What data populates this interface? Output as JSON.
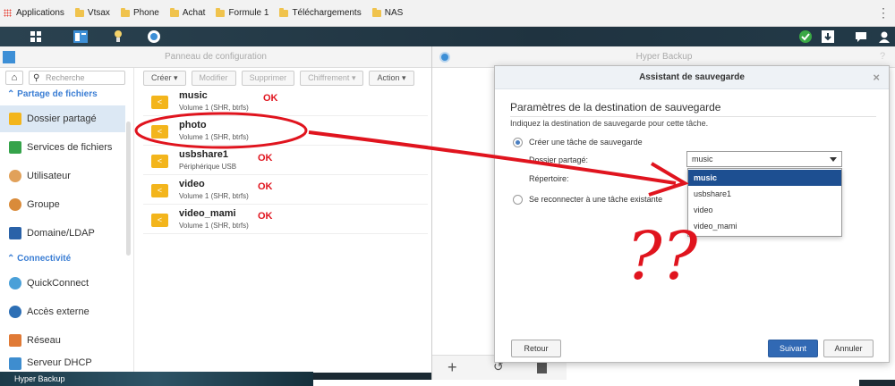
{
  "bookmarks": {
    "apps_label": "Applications",
    "items": [
      "Vtsax",
      "Phone",
      "Achat",
      "Formule 1",
      "Téléchargements",
      "NAS"
    ]
  },
  "control_panel": {
    "title": "Panneau de configuration",
    "search_placeholder": "Recherche",
    "sections": {
      "file_sharing": "Partage de fichiers",
      "connectivity": "Connectivité"
    },
    "sidebar_items": [
      {
        "label": "Dossier partagé",
        "icon": "shared-folder-icon",
        "active": true
      },
      {
        "label": "Services de fichiers",
        "icon": "file-services-icon"
      },
      {
        "label": "Utilisateur",
        "icon": "user-icon"
      },
      {
        "label": "Groupe",
        "icon": "group-icon"
      },
      {
        "label": "Domaine/LDAP",
        "icon": "domain-icon"
      },
      {
        "label": "QuickConnect",
        "icon": "quickconnect-icon"
      },
      {
        "label": "Accès externe",
        "icon": "external-access-icon"
      },
      {
        "label": "Réseau",
        "icon": "network-icon"
      },
      {
        "label": "Serveur DHCP",
        "icon": "dhcp-icon"
      }
    ],
    "toolbar": {
      "create": "Créer",
      "modify": "Modifier",
      "delete": "Supprimer",
      "encryption": "Chiffrement",
      "action": "Action"
    },
    "folders": [
      {
        "name": "music",
        "sub": "Volume 1 (SHR, btrfs)",
        "mark": "OK"
      },
      {
        "name": "photo",
        "sub": "Volume 1 (SHR, btrfs)",
        "mark": ""
      },
      {
        "name": "usbshare1",
        "sub": "Périphérique USB",
        "mark": "OK"
      },
      {
        "name": "video",
        "sub": "Volume 1 (SHR, btrfs)",
        "mark": "OK"
      },
      {
        "name": "video_mami",
        "sub": "Volume 1 (SHR, btrfs)",
        "mark": "OK"
      }
    ]
  },
  "hyper_backup": {
    "title": "Hyper Backup"
  },
  "wizard": {
    "title": "Assistant de sauvegarde",
    "heading": "Paramètres de la destination de sauvegarde",
    "description": "Indiquez la destination de sauvegarde pour cette tâche.",
    "option_create": "Créer une tâche de sauvegarde",
    "label_shared_folder": "Dossier partagé:",
    "label_directory": "Répertoire:",
    "option_reconnect": "Se reconnecter à une tâche existante",
    "dropdown_value": "music",
    "dropdown_options": [
      "music",
      "usbshare1",
      "video",
      "video_mami"
    ],
    "btn_back": "Retour",
    "btn_next": "Suivant",
    "btn_cancel": "Annuler"
  },
  "desktop": {
    "taskbar_label": "Hyper Backup"
  },
  "annotation": {
    "question_marks": "??"
  },
  "colors": {
    "accent": "#3169b4",
    "annotation_red": "#e0141e",
    "folder_yellow": "#f3b51c"
  }
}
